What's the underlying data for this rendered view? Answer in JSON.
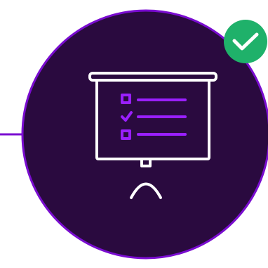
{
  "illustration": {
    "subject": "presentation-board-checklist",
    "icons": {
      "board": "presentation-board-icon",
      "checklist": "checklist-icon",
      "badge": "checkmark-badge-icon"
    },
    "colors": {
      "background": "#ffffff",
      "circle_fill": "#2a0a3f",
      "circle_ring": "#7a0cd0",
      "connector_line": "#7a0cd0",
      "board_stroke": "#ffffff",
      "checklist_accent": "#9a1fff",
      "badge_fill": "#1fb16a",
      "badge_check": "#ffffff"
    },
    "checklist": {
      "item_count": 3,
      "checked_items": [
        2
      ]
    }
  }
}
